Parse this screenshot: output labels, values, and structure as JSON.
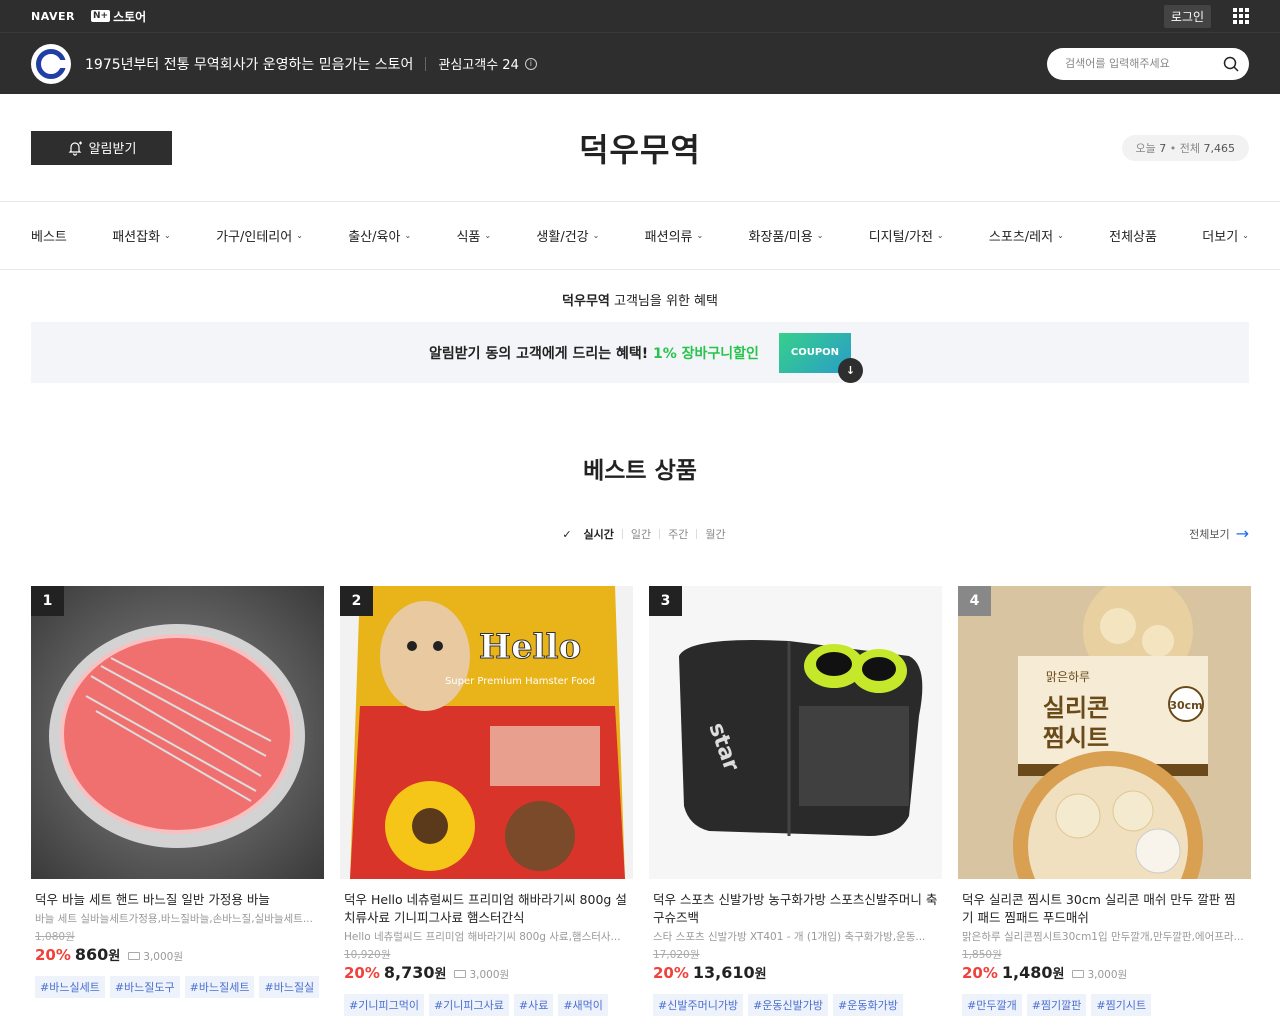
{
  "gnb": {
    "naver": "NAVER",
    "nplus_box": "N+",
    "nplus_text": "스토어",
    "login": "로그인"
  },
  "store": {
    "slogan": "1975년부터 전통 무역회사가 운영하는 믿음가는 스토어",
    "fans": "관심고객수 24",
    "search_placeholder": "검색어를 입력해주세요"
  },
  "header": {
    "notify_label": "알림받기",
    "title": "덕우무역",
    "today_label": "오늘",
    "today_count": "7",
    "total_label": "전체",
    "total_count": "7,465"
  },
  "categories": [
    "베스트",
    "패션잡화",
    "가구/인테리어",
    "출산/육아",
    "식품",
    "생활/건강",
    "패션의류",
    "화장품/미용",
    "디지털/가전",
    "스포츠/레저",
    "전체상품",
    "더보기"
  ],
  "categories_with_chevron": [
    false,
    true,
    true,
    true,
    true,
    true,
    true,
    true,
    true,
    true,
    false,
    true
  ],
  "benefit": {
    "store": "덕우무역",
    "suffix": " 고객님을 위한 혜택",
    "banner_text": "알림받기 동의 고객에게 드리는 혜택! ",
    "banner_highlight": "1% 장바구니할인",
    "coupon_label": "COUPON"
  },
  "best": {
    "title": "베스트 상품",
    "periods": [
      "실시간",
      "일간",
      "주간",
      "월간"
    ],
    "active_period": "실시간",
    "view_all": "전체보기"
  },
  "products": [
    {
      "rank": "1",
      "name": "덕우 바늘 세트 핸드 바느질 일반 가정용 바늘",
      "desc": "바늘 세트 실바늘세트가정용,바느질바늘,손바느질,실바늘세트...",
      "original": "1,080원",
      "discount": "20%",
      "price": "860",
      "won": "원",
      "shipping": "3,000원",
      "tags": [
        "#바느실세트",
        "#바느질도구",
        "#바느질세트",
        "#바느질실"
      ]
    },
    {
      "rank": "2",
      "name": "덕우 Hello 네츄럴씨드 프리미엄 해바라기씨 800g 설치류사료 기니피그사료 햄스터간식",
      "desc": "Hello 네츄럴씨드 프리미엄 해바라기씨 800g 사료,햄스터사...",
      "original": "10,920원",
      "discount": "20%",
      "price": "8,730",
      "won": "원",
      "shipping": "3,000원",
      "tags": [
        "#기니피그먹이",
        "#기니피그사료",
        "#사료",
        "#새먹이"
      ]
    },
    {
      "rank": "3",
      "name": "덕우 스포츠 신발가방 농구화가방 스포츠신발주머니 축구슈즈백",
      "desc": "스타 스포츠 신발가방 XT401 - 개 (1개입) 축구화가방,운동...",
      "original": "17,020원",
      "discount": "20%",
      "price": "13,610",
      "won": "원",
      "shipping": "",
      "tags": [
        "#신발주머니가방",
        "#운동신발가방",
        "#운동화가방"
      ]
    },
    {
      "rank": "4",
      "name": "덕우 실리콘 찜시트 30cm 실리콘 매쉬 만두 깔판 찜기 패드 찜패드 푸드매쉬",
      "desc": "맑은하루 실리콘찜시트30cm1입 만두깔개,만두깔판,에어프라...",
      "original": "1,850원",
      "discount": "20%",
      "price": "1,480",
      "won": "원",
      "shipping": "3,000원",
      "tags": [
        "#만두깔개",
        "#찜기깔판",
        "#찜기시트"
      ]
    }
  ],
  "image_text": {
    "p2_brand": "Hello",
    "p2_sub": "Super Premium Hamster Food",
    "p3_brand": "star",
    "p4_brand": "맑은하루",
    "p4_title": "실리콘 찜시트",
    "p4_size": "30cm"
  },
  "colors": {
    "dark": "#2e2e2e",
    "accent_green": "#28c34c",
    "discount_red": "#f0413a",
    "tag_blue": "#4a6fd0"
  }
}
